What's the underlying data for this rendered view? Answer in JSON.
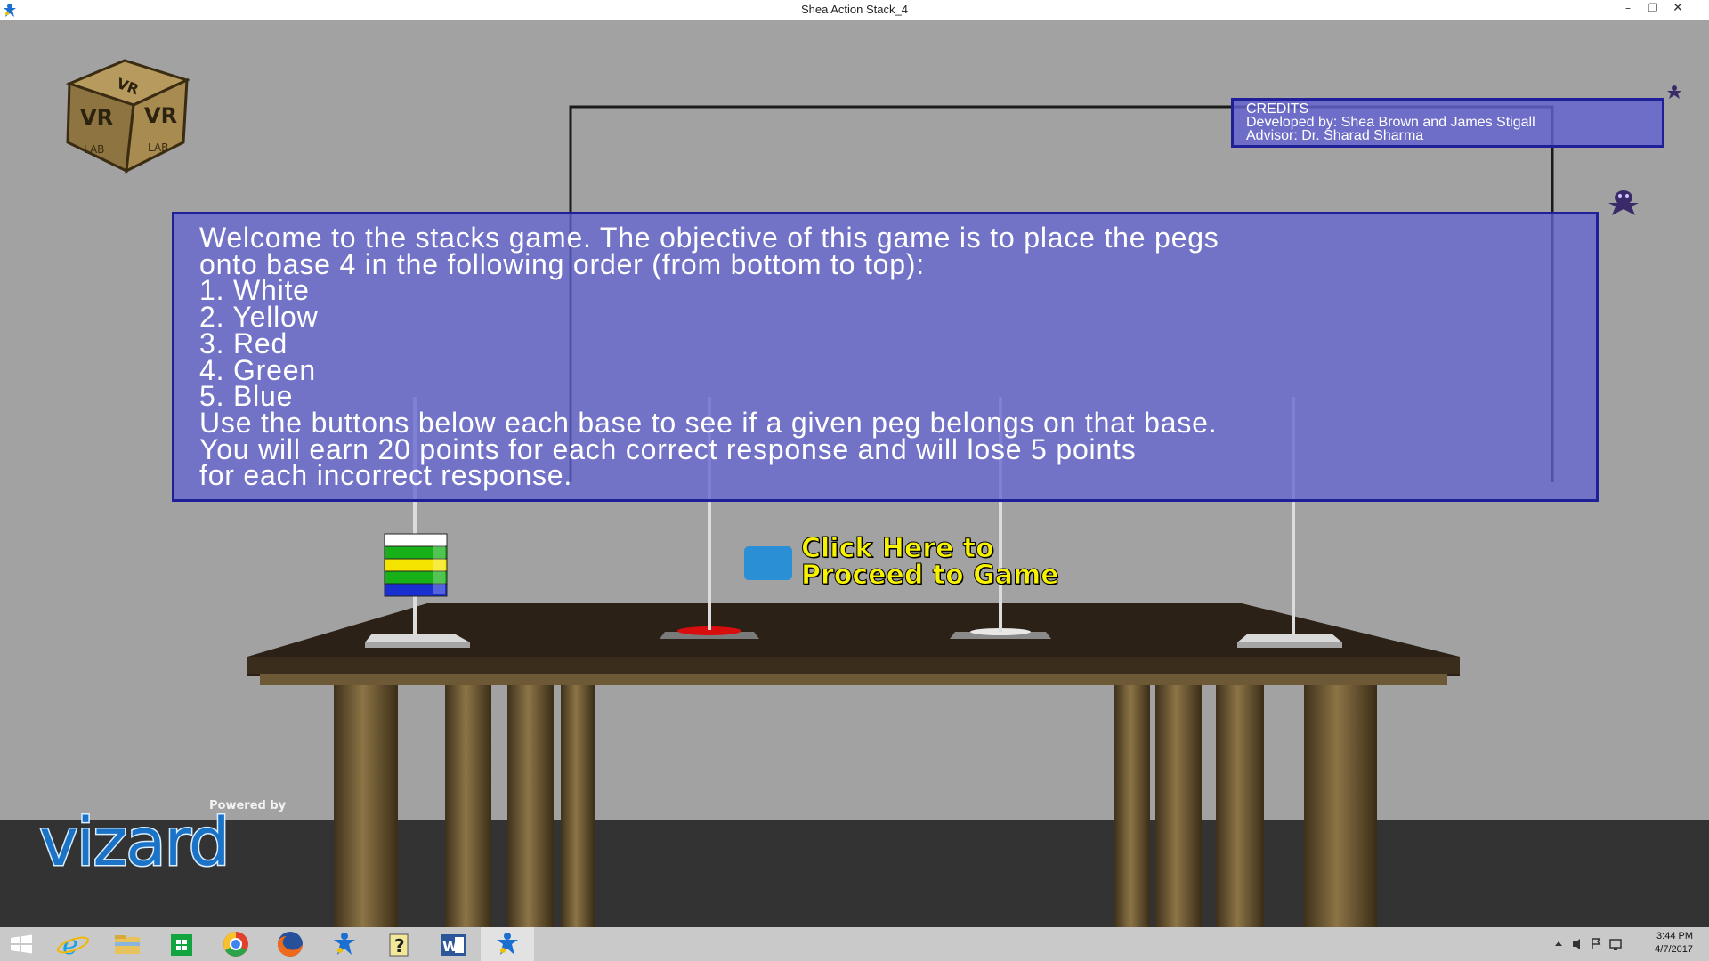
{
  "window": {
    "title": "Shea Action Stack_4",
    "controls": [
      "minimize",
      "restore",
      "close"
    ]
  },
  "welcome": {
    "lines": [
      "Welcome to the stacks game.  The objective of this game is to place the pegs",
      "onto base 4 in the following order (from bottom to top):",
      "1. White",
      "2. Yellow",
      "3. Red",
      "4. Green",
      "5. Blue",
      "Use the buttons below each base to see if a given peg belongs on that base.",
      "You will earn 20 points for each correct response and will lose 5 points",
      "for each incorrect response."
    ]
  },
  "credits": {
    "title": "CREDITS",
    "developed_by": "Developed by: Shea Brown and James Stigall",
    "advisor": "Advisor: Dr. Sharad Sharma"
  },
  "proceed": {
    "line1": "Click Here to",
    "line2": "Proceed to Game"
  },
  "logos": {
    "lab_cube": "VR LAB",
    "vizard_powered": "Powered by",
    "vizard": "vizard"
  },
  "peg_stack_colors": [
    "#ffffff",
    "#f5e400",
    "#1a5fcf",
    "#d80e0e",
    "#18b018"
  ],
  "taskbar": {
    "icons": [
      "windows-start-icon",
      "internet-explorer-icon",
      "file-explorer-icon",
      "windows-store-icon",
      "chrome-icon",
      "firefox-icon",
      "vizard-app-icon",
      "help-icon",
      "word-icon",
      "vizard-app-active-icon"
    ],
    "time": "3:44 PM",
    "date": "4/7/2017"
  },
  "colors": {
    "panel_fill": "#6b6bd6",
    "panel_border": "#1f1f9a",
    "proceed_button": "#2a8fd4",
    "proceed_text": "#f7f200"
  }
}
